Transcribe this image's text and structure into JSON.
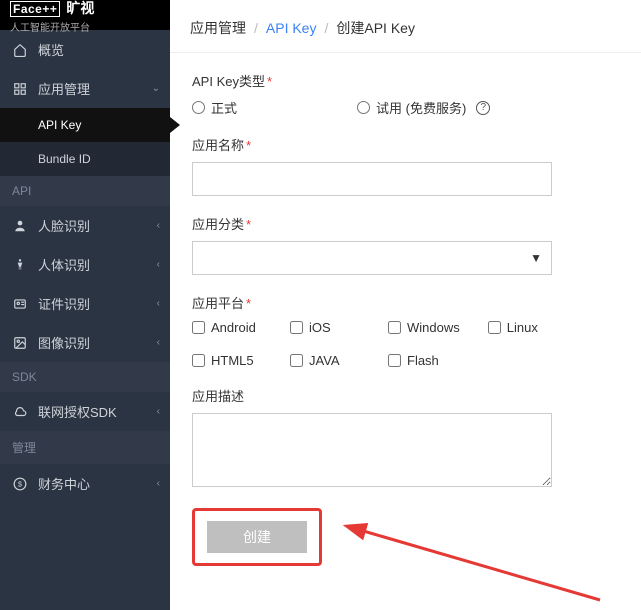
{
  "brand": {
    "name": "Face++",
    "megvii": "旷视",
    "sub": "人工智能开放平台"
  },
  "sidebar": {
    "overview": "概览",
    "appmgmt": "应用管理",
    "sub": {
      "apikey": "API Key",
      "bundleid": "Bundle ID"
    },
    "section_api": "API",
    "face": "人脸识别",
    "body": "人体识别",
    "cert": "证件识别",
    "image": "图像识别",
    "section_sdk": "SDK",
    "sdk": "联网授权SDK",
    "section_mgmt": "管理",
    "finance": "财务中心"
  },
  "crumbs": {
    "a": "应用管理",
    "b": "API Key",
    "c": "创建API Key"
  },
  "form": {
    "type_label": "API Key类型",
    "type_opts": {
      "formal": "正式",
      "trial": "试用 (免费服务)"
    },
    "name_label": "应用名称",
    "name_value": "",
    "cat_label": "应用分类",
    "cat_value": "",
    "plat_label": "应用平台",
    "plats": [
      "Android",
      "iOS",
      "Windows",
      "Linux",
      "HTML5",
      "JAVA",
      "Flash"
    ],
    "desc_label": "应用描述",
    "desc_value": "",
    "submit": "创建"
  }
}
